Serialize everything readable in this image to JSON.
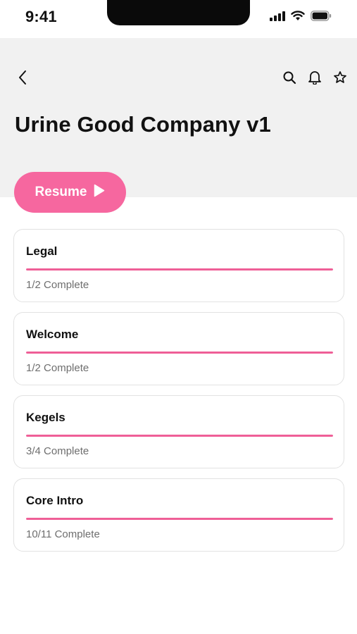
{
  "status_bar": {
    "time": "9:41",
    "icons": [
      "signal-icon",
      "wifi-icon",
      "battery-icon"
    ]
  },
  "header": {
    "title": "Urine Good Company v1",
    "back_icon": "chevron-left-icon",
    "actions": [
      "search-icon",
      "bell-icon",
      "star-icon"
    ]
  },
  "resume": {
    "label": "Resume",
    "icon": "play-icon"
  },
  "modules": [
    {
      "title": "Legal",
      "status": "1/2 Complete",
      "progress": 1.0
    },
    {
      "title": "Welcome",
      "status": "1/2 Complete",
      "progress": 1.0
    },
    {
      "title": "Kegels",
      "status": "3/4 Complete",
      "progress": 1.0
    },
    {
      "title": "Core Intro",
      "status": "10/11 Complete",
      "progress": 1.0
    }
  ],
  "colors": {
    "accent": "#f6679f",
    "progress": "#ef5f97",
    "header_bg": "#f1f1f1",
    "muted_text": "#6e6e6e"
  }
}
